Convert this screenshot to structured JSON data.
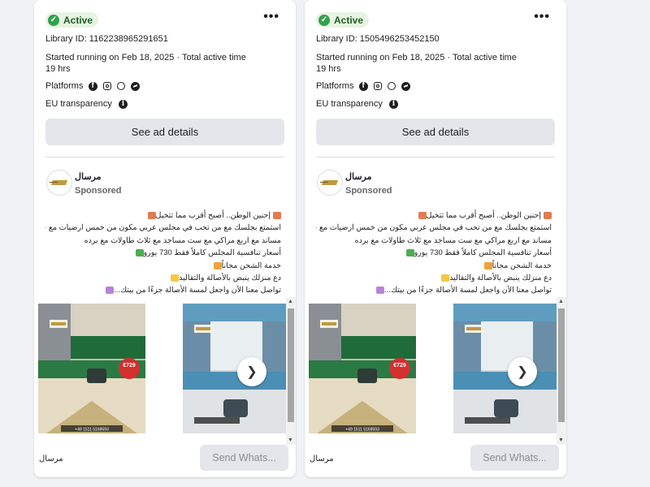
{
  "cards": [
    {
      "status": "Active",
      "library_id": "Library ID: 1162238965291651",
      "started": "Started running on Feb 18, 2025 · Total active time",
      "duration": "19 hrs",
      "platforms_label": "Platforms",
      "eu_label": "EU transparency",
      "details_button": "See ad details",
      "page_name": "مرسال",
      "sponsored": "Sponsored",
      "body_lines": [
        "إحنين الوطن.. أصبح أقرب مما تتخيل",
        "استمتع بجلسك مع من تحب في مجلس عربي مكون من خمس ارضيات مع خمس",
        "مساند مع اربع مراكي مع ست مساجد مع ثلاث طاولات مع برده",
        "أسعار تنافسية المجلس كاملاً فقط 730 يورو",
        "خدمة الشحن مجاناً",
        "دع منزلك ينبض بالأصالة والتقاليد",
        "تواصل معنا الآن واجعل لمسة الأصالة جزءًا من بيتك..."
      ],
      "footer_name": "مرسال",
      "send_button": "Send Whats..."
    },
    {
      "status": "Active",
      "library_id": "Library ID: 1505496253452150",
      "started": "Started running on Feb 18, 2025 · Total active time",
      "duration": "19 hrs",
      "platforms_label": "Platforms",
      "eu_label": "EU transparency",
      "details_button": "See ad details",
      "page_name": "مرسال",
      "sponsored": "Sponsored",
      "body_lines": [
        "إحنين الوطن.. أصبح أقرب مما تتخيل",
        "استمتع بجلسك مع من تحب في مجلس عربي مكون من خمس ارضيات مع خمس",
        "مساند مع اربع مراكي مع ست مساجد مع ثلاث طاولات مع برده",
        "أسعار تنافسية المجلس كاملاً فقط 730 يورو",
        "خدمة الشحن مجاناً",
        "دع منزلك ينبض بالأصالة والتقاليد",
        "تواصل معنا الآن واجعل لمسة الأصالة جزءًا من بيتك..."
      ],
      "footer_name": "مرسال",
      "send_button": "Send Whats..."
    }
  ],
  "platform_icons": [
    "facebook-icon",
    "instagram-icon",
    "audience-network-icon",
    "messenger-icon"
  ],
  "slide_text": {
    "price": "€729",
    "phone": "+49 1511 5169593"
  },
  "colors": {
    "active_green": "#31a24c",
    "sofa_green": "#1f6b3a",
    "sofa_blue": "#4a8fb5",
    "price_red": "#d32f2f"
  }
}
